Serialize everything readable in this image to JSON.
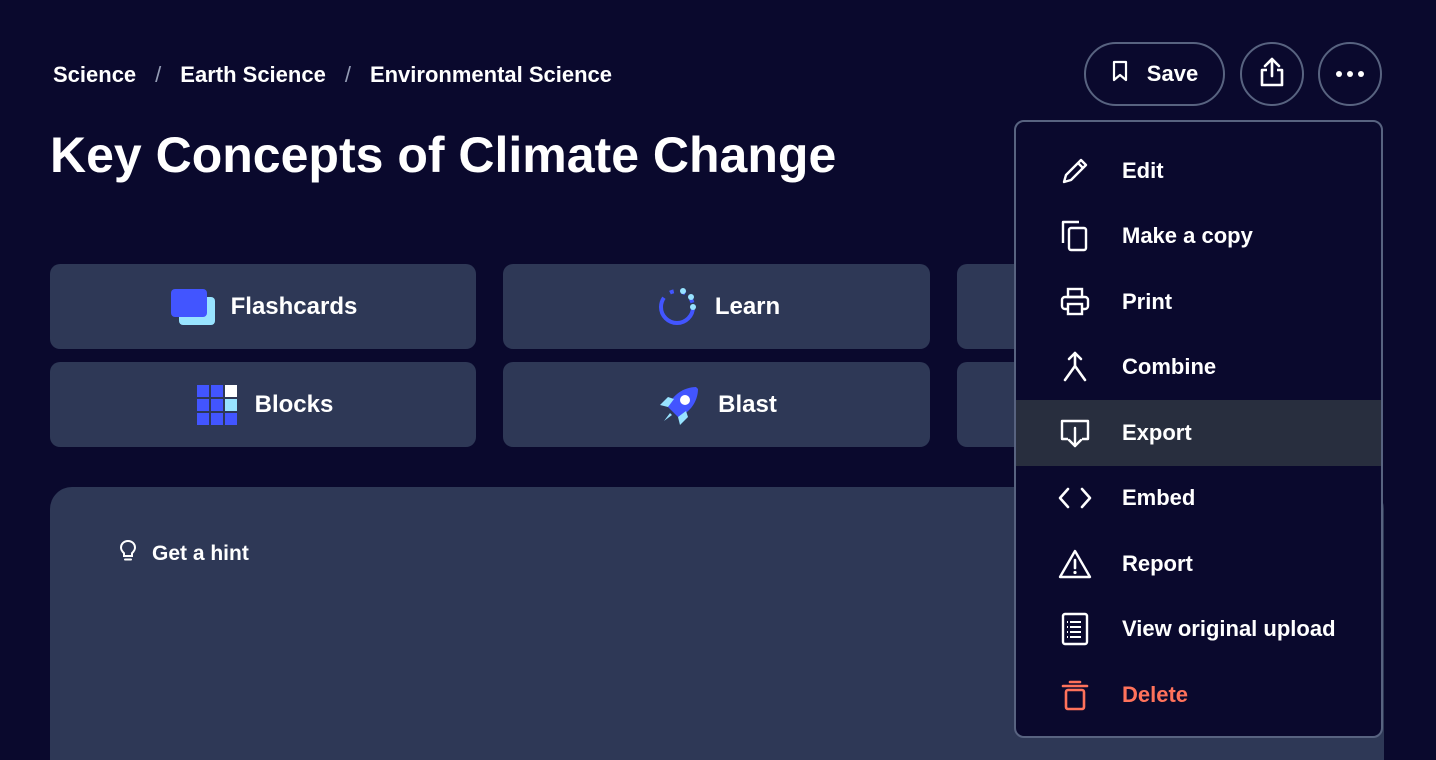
{
  "breadcrumb": {
    "items": [
      "Science",
      "Earth Science",
      "Environmental Science"
    ],
    "separator": "/"
  },
  "page_title": "Key Concepts of Climate Change",
  "actions": {
    "save_label": "Save",
    "share_icon": "share-icon",
    "more_icon": "more-horizontal-icon"
  },
  "study_modes": [
    {
      "label": "Flashcards",
      "icon": "flashcards-icon"
    },
    {
      "label": "Learn",
      "icon": "learn-icon"
    },
    {
      "label": "Blocks",
      "icon": "blocks-icon"
    },
    {
      "label": "Blast",
      "icon": "blast-rocket-icon"
    }
  ],
  "flashcard": {
    "hint_label": "Get a hint",
    "hint_icon": "lightbulb-icon"
  },
  "menu": {
    "items": [
      {
        "label": "Edit",
        "icon": "pencil-icon"
      },
      {
        "label": "Make a copy",
        "icon": "copy-icon"
      },
      {
        "label": "Print",
        "icon": "printer-icon"
      },
      {
        "label": "Combine",
        "icon": "merge-icon"
      },
      {
        "label": "Export",
        "icon": "export-icon",
        "highlighted": true
      },
      {
        "label": "Embed",
        "icon": "code-icon"
      },
      {
        "label": "Report",
        "icon": "warning-icon"
      },
      {
        "label": "View original upload",
        "icon": "document-icon"
      },
      {
        "label": "Delete",
        "icon": "trash-icon",
        "danger": true
      }
    ]
  },
  "colors": {
    "background": "#0a092d",
    "tile": "#2e3856",
    "border": "#586380",
    "menu_highlight": "#282e3e",
    "danger": "#ff725b",
    "accent_blue": "#4255ff"
  }
}
